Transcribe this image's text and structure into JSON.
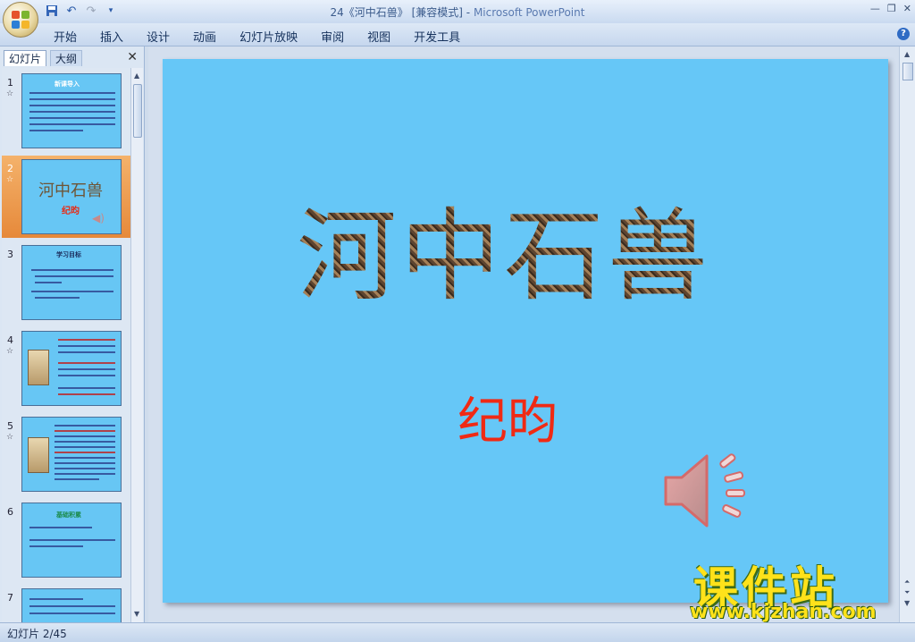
{
  "titlebar": {
    "title": "24《河中石兽》 [兼容模式] - ",
    "app": "Microsoft PowerPoint",
    "icons": [
      "save-icon",
      "undo-icon",
      "redo-icon",
      "customize-icon"
    ]
  },
  "ribbon": {
    "tabs": [
      "开始",
      "插入",
      "设计",
      "动画",
      "幻灯片放映",
      "审阅",
      "视图",
      "开发工具"
    ],
    "help": "?"
  },
  "panel": {
    "tab_slides": "幻灯片",
    "tab_outline": "大纲",
    "close": "✕"
  },
  "thumbnails": [
    {
      "num": "1",
      "star": "☆",
      "title": "新课导入"
    },
    {
      "num": "2",
      "star": "☆",
      "title": "河中石兽",
      "sub": "纪昀"
    },
    {
      "num": "3",
      "star": "",
      "title": "学习目标"
    },
    {
      "num": "4",
      "star": "☆"
    },
    {
      "num": "5",
      "star": "☆"
    },
    {
      "num": "6",
      "star": "",
      "title": "基础积累"
    },
    {
      "num": "7",
      "star": ""
    }
  ],
  "slide": {
    "title": "河中石兽",
    "subtitle": "纪昀",
    "bg": "#66c7f7"
  },
  "watermark": {
    "title": "课件站",
    "url": "www.kjzhan.com"
  },
  "status": {
    "text": "幻灯片 2/45"
  }
}
